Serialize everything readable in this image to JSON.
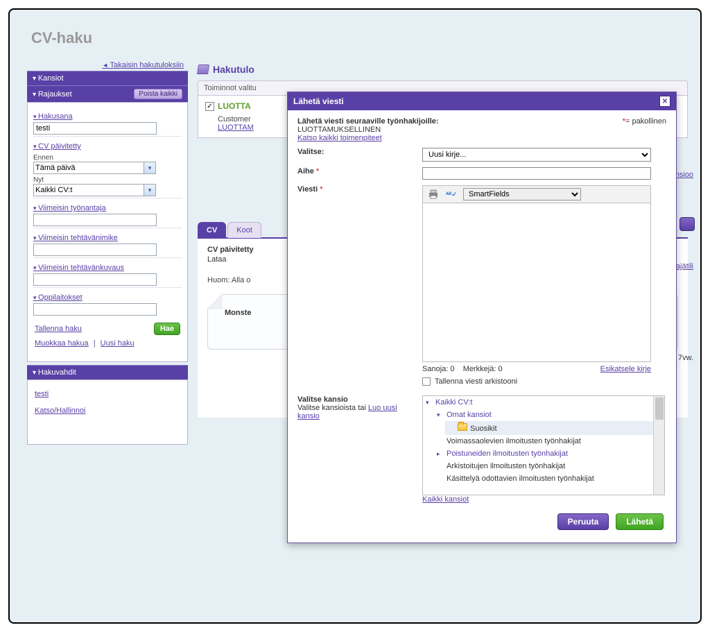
{
  "page_title": "CV-haku",
  "back_link": "Takaisin hakutuloksiin",
  "sidebar": {
    "folders_header": "Kansiot",
    "filters_header": "Rajaukset",
    "clear_all_btn": "Poista kaikki",
    "sections": {
      "keyword": {
        "title": "Hakusana",
        "value": "testi"
      },
      "cv_updated": {
        "title": "CV päivitetty",
        "before_label": "Ennen",
        "before_value": "Tämä päivä",
        "now_label": "Nyt",
        "now_value": "Kaikki CV:t"
      },
      "last_employer": {
        "title": "Viimeisin työnantaja"
      },
      "last_jobtitle": {
        "title": "Viimeisin tehtävänimike"
      },
      "last_jobdesc": {
        "title": "Viimeisin tehtävänkuvaus"
      },
      "schools": {
        "title": "Oppilaitokset"
      }
    },
    "save_search": "Tallenna haku",
    "search_btn": "Hae",
    "edit_search": "Muokkaa hakua",
    "new_search": "Uusi haku",
    "hakuvahdit_header": "Hakuvahdit",
    "hakuvahdit_item": "testi",
    "hakuvahdit_manage": "Katso/Hallinnoi"
  },
  "main": {
    "results_title": "Hakutulo",
    "toolbar_text": "Toiminnot valitu",
    "result_name": "LUOTTA",
    "customer_label": "Customer",
    "customer_link": "LUOTTAM",
    "tabs": {
      "cv": "CV",
      "koot": "Koot"
    },
    "cv_updated_label": "CV päivitetty",
    "download": "Lataa",
    "note": "Huom: Alla o",
    "monste": "Monste",
    "cut_links": {
      "nsioo": "nsioo",
      "ajatili": "ajätili",
      "sevenvw": "7vw."
    }
  },
  "modal": {
    "title": "Lähetä viesti",
    "recipients_label": "Lähetä viesti seuraaville työnhakijoille:",
    "recipient_name": "LUOTTAMUKSELLINEN",
    "see_all_actions": "Katso kaikki toimenpiteet",
    "required_note": "= pakollinen",
    "select_label": "Valitse:",
    "select_value": "Uusi kirje...",
    "subject_label": "Aihe",
    "message_label": "Viesti",
    "smartfields": "SmartFields",
    "words_label": "Sanoja: 0",
    "chars_label": "Merkkejä: 0",
    "preview_link": "Esikatsele kirje",
    "save_archive": "Tallenna viesti arkistooni",
    "folder_section_title": "Valitse kansio",
    "folder_section_sub": "Valitse kansioista tai",
    "create_folder_link": "Luo uusi kansio",
    "tree": {
      "root": "Kaikki CV:t",
      "own_folders": "Omat kansiot",
      "favorites": "Suosikit",
      "active_jobs": "Voimassaolevien ilmoitusten työnhakijat",
      "deleted_jobs": "Poistuneiden ilmoitusten työnhakijat",
      "archived_jobs": "Arkistoitujen ilmoitusten työnhakijat",
      "pending_jobs": "Käsittelyä odottavien ilmoitusten työnhakijat"
    },
    "all_folders_link": "Kaikki kansiot",
    "cancel_btn": "Peruuta",
    "send_btn": "Lähetä"
  }
}
